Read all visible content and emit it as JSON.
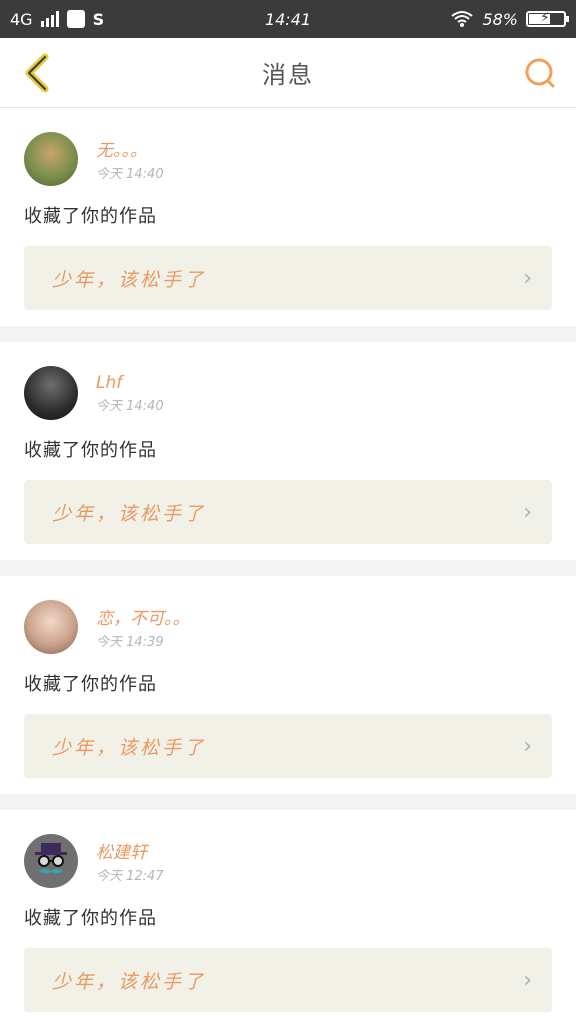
{
  "status_bar": {
    "network": "4G",
    "time": "14:41",
    "battery": "58%"
  },
  "header": {
    "title": "消息"
  },
  "notifications": [
    {
      "user": "无。。。",
      "time": "今天 14:40",
      "action": "收藏了你的作品",
      "work": "少年，该松手了"
    },
    {
      "user": "Lhf",
      "time": "今天 14:40",
      "action": "收藏了你的作品",
      "work": "少年，该松手了"
    },
    {
      "user": "恋，不可。。",
      "time": "今天 14:39",
      "action": "收藏了你的作品",
      "work": "少年，该松手了"
    },
    {
      "user": "松建轩",
      "time": "今天 12:47",
      "action": "收藏了你的作品",
      "work": "少年，该松手了"
    }
  ],
  "colors": {
    "accent": "#e99a63",
    "back_icon": "#e5c93b",
    "search_icon": "#f0a15a",
    "status_bar": "#3b3b3b"
  },
  "icons": {
    "back": "back-arrow-icon",
    "search": "search-icon",
    "chevron": "chevron-right-icon"
  }
}
